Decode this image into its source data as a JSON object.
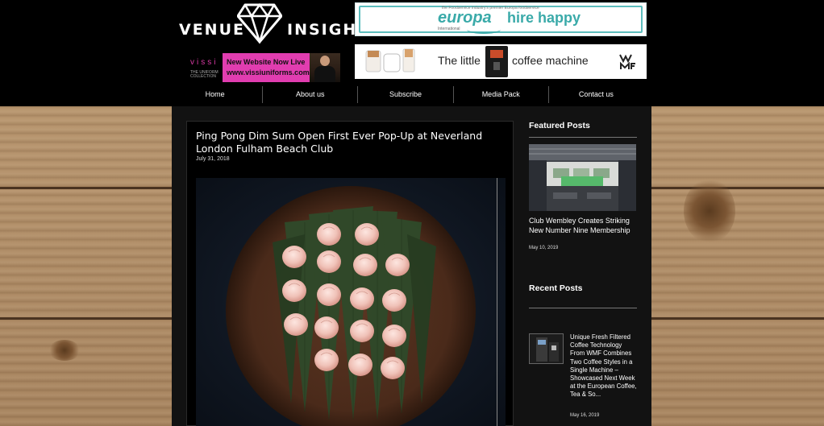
{
  "site": {
    "logo_left": "VENUE",
    "logo_right": "INSIGHT"
  },
  "ads": {
    "europa": {
      "tagline": "the Foodservice industry's premier Europa foodservice",
      "brand": "europa",
      "sub": "International",
      "slogan": "hire happy"
    },
    "vissi": {
      "brand": "vissi",
      "collection": "THE UNIFORM COLLECTION",
      "headline": "New Website Now Live",
      "url": "www.vissiuniforms.com"
    },
    "wmf": {
      "text_left": "The little",
      "text_right": "coffee machine",
      "logo": "WMF"
    }
  },
  "nav": {
    "items": [
      "Home",
      "About us",
      "Subscribe",
      "Media Pack",
      "Contact us"
    ]
  },
  "post": {
    "title": "Ping Pong Dim Sum Open First Ever Pop-Up at Neverland London Fulham Beach Club",
    "date": "July 31, 2018",
    "image_icon": "dim-sum-photo"
  },
  "sidebar": {
    "featured_heading": "Featured Posts",
    "featured": {
      "title": "Club Wembley Creates Striking New Number Nine Membership",
      "date": "May 10, 2019"
    },
    "recent_heading": "Recent Posts",
    "recent": {
      "title": "Unique Fresh Filtered Coffee Technology From WMF Combines Two Coffee Styles in a Single Machine – Showcased Next Week at the European Coffee, Tea & So...",
      "date": "May 16, 2019"
    }
  },
  "colors": {
    "header_bg": "#000000",
    "accent_teal": "#3aaaa9",
    "vissi_pink": "#e13db0",
    "wood": "#b8966f"
  }
}
